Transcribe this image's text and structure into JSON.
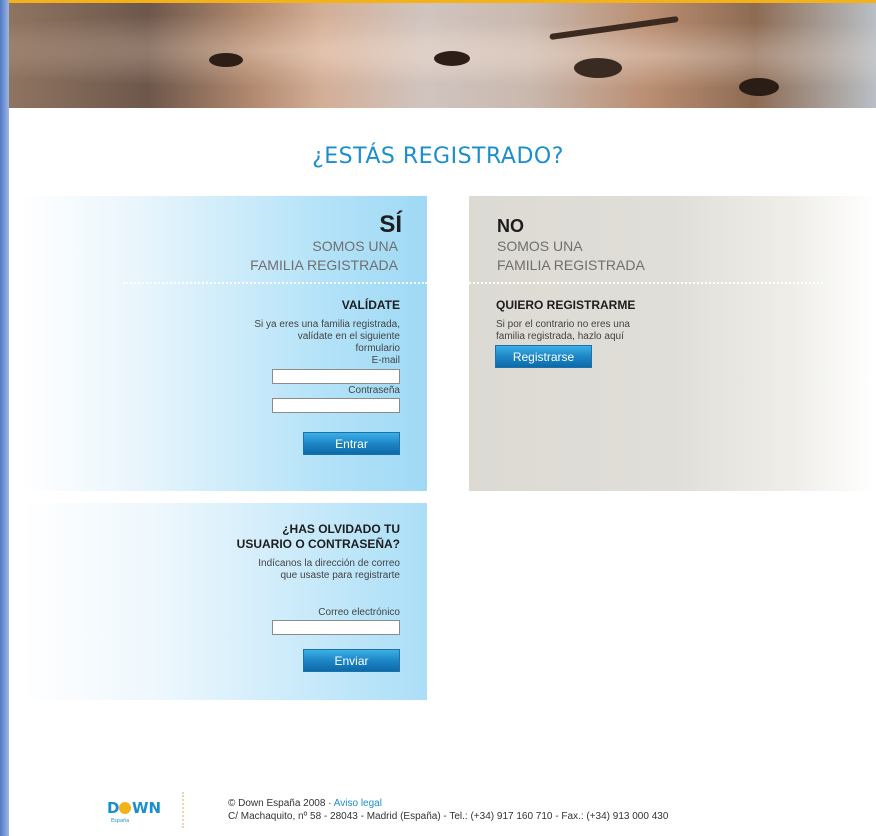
{
  "page": {
    "title": "¿ESTÁS REGISTRADO?"
  },
  "yes_panel": {
    "heading": "SÍ",
    "sub1": "SOMOS UNA",
    "sub2": "FAMILIA REGISTRADA",
    "section_title": "VALÍDATE",
    "desc1": "Si ya eres una familia registrada,",
    "desc2": "valídate en el siguiente",
    "desc3": "formulario",
    "email_label": "E-mail",
    "email_value": "",
    "password_label": "Contraseña",
    "password_value": "",
    "submit_label": "Entrar"
  },
  "no_panel": {
    "heading": "NO",
    "sub1": "SOMOS UNA",
    "sub2": "FAMILIA REGISTRADA",
    "section_title": "QUIERO REGISTRARME",
    "desc1": "Si por el contrario no eres una",
    "desc2": "familia registrada, hazlo aquí",
    "register_label": "Registrarse"
  },
  "forgot_panel": {
    "title1": "¿HAS OLVIDADO TU",
    "title2": "USUARIO O CONTRASEÑA?",
    "desc1": "Indícanos la dirección de correo",
    "desc2": "que usaste para registrarte",
    "email_label": "Correo electrónico",
    "email_value": "",
    "submit_label": "Enviar"
  },
  "footer": {
    "logo_text": "D WN",
    "logo_sub": "España",
    "copyright": "© Down España 2008 · ",
    "legal_link": "Aviso legal",
    "address": "C/ Machaquito, nº 58 - 28043 - Madrid (España) - Tel.: (+34) 917 160 710 - Fax.: (+34) 913 000 430"
  },
  "colors": {
    "accent": "#1a8fcb",
    "button": "#1e86c5",
    "top_line": "#f3b21b",
    "left_edge": "#4f79c4"
  }
}
